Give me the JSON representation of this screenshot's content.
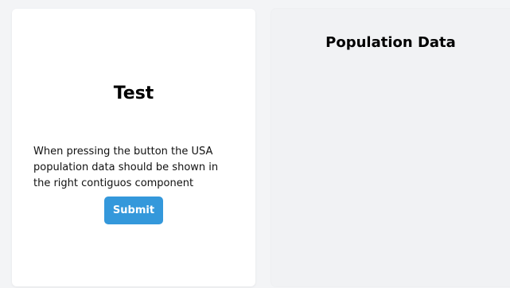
{
  "left_card": {
    "title": "Test",
    "description": "When pressing the button the USA population data should be shown in the right contiguos component",
    "submit_label": "Submit"
  },
  "right_panel": {
    "title": "Population Data"
  },
  "colors": {
    "accent": "#3498db",
    "card_background": "#ffffff",
    "panel_background": "#f1f2f4",
    "page_background": "#f3f4f6"
  }
}
